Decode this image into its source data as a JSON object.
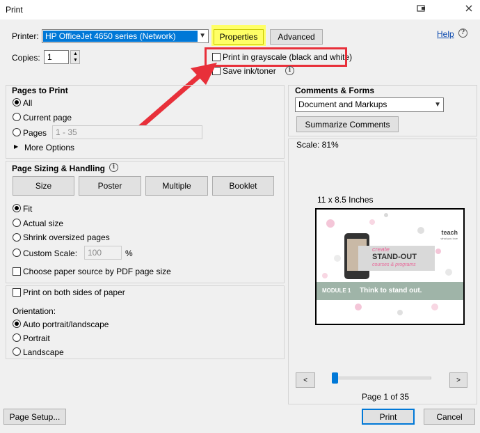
{
  "window": {
    "title": "Print"
  },
  "printer": {
    "label": "Printer:",
    "selected": "HP OfficeJet 4650 series (Network)",
    "properties_label": "Properties",
    "advanced_label": "Advanced",
    "help_label": "Help",
    "copies_label": "Copies:",
    "copies_value": "1",
    "grayscale_label": "Print in grayscale (black and white)",
    "save_ink_label": "Save ink/toner"
  },
  "pages_to_print": {
    "heading": "Pages to Print",
    "all": "All",
    "current": "Current page",
    "pages": "Pages",
    "pages_placeholder": "1 - 35",
    "more_options": "More Options"
  },
  "sizing": {
    "heading": "Page Sizing & Handling",
    "tabs": [
      "Size",
      "Poster",
      "Multiple",
      "Booklet"
    ],
    "fit": "Fit",
    "actual": "Actual size",
    "shrink": "Shrink oversized pages",
    "custom": "Custom Scale:",
    "custom_value": "100",
    "percent": "%",
    "paper_source": "Choose paper source by PDF page size",
    "both_sides": "Print on both sides of paper",
    "orientation_label": "Orientation:",
    "auto": "Auto portrait/landscape",
    "portrait": "Portrait",
    "landscape": "Landscape"
  },
  "comments": {
    "heading": "Comments & Forms",
    "selected": "Document and Markups",
    "summarize_label": "Summarize Comments"
  },
  "preview": {
    "scale": "Scale:  81%",
    "paper_size": "11 x 8.5 Inches",
    "page_indicator": "Page 1 of 35",
    "prev": "<",
    "next": ">",
    "slide": {
      "logo": "teach",
      "logo_sub": "what you love",
      "line1": "create",
      "line2": "STAND-OUT",
      "line3": "courses & programs",
      "module": "MODULE 1",
      "module_text": "Think to stand out."
    }
  },
  "footer": {
    "page_setup": "Page Setup...",
    "print": "Print",
    "cancel": "Cancel"
  },
  "colors": {
    "highlight": "#ffff66",
    "annotation": "#e8303a",
    "selection": "#0078d7"
  }
}
